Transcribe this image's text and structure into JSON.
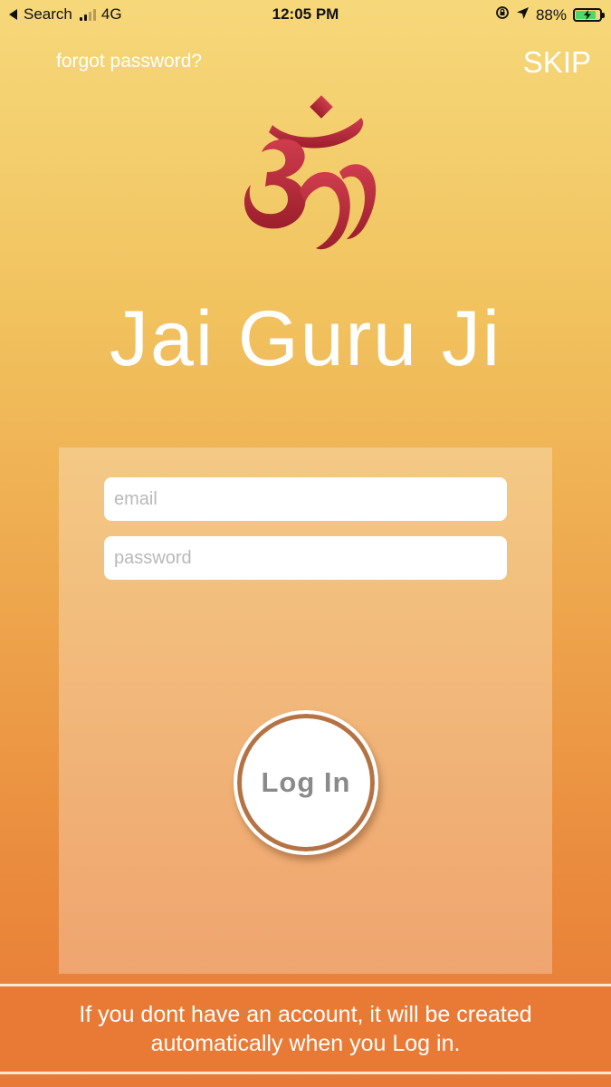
{
  "status_bar": {
    "back_label": "Search",
    "network": "4G",
    "time": "12:05 PM",
    "battery": "88%",
    "battery_level": 0.88
  },
  "header": {
    "forgot_password": "forgot password?",
    "skip": "SKIP"
  },
  "brand": {
    "title": "Jai Guru Ji",
    "logo_icon": "om-icon",
    "logo_color": "#b22a36"
  },
  "form": {
    "email_placeholder": "email",
    "password_placeholder": "password",
    "login_label": "Log In"
  },
  "footer": {
    "note": "If you dont have an account, it will be created automatically when you Log in."
  },
  "colors": {
    "gradient_top": "#f6d87a",
    "gradient_bottom": "#e87a35",
    "footer_bg": "#e97a36",
    "button_ring": "#b57343"
  }
}
